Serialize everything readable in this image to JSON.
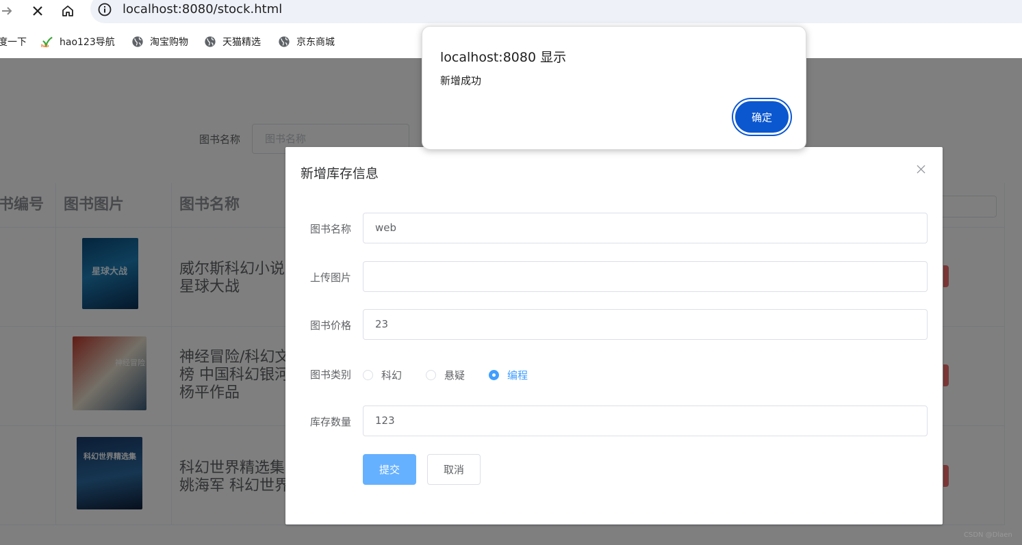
{
  "browser": {
    "url": "localhost:8080/stock.html",
    "bookmarks": [
      {
        "label": "度一下",
        "icon": "partial-clipped"
      },
      {
        "label": "hao123导航",
        "icon": "hao123-icon"
      },
      {
        "label": "淘宝购物",
        "icon": "globe-icon"
      },
      {
        "label": "天猫精选",
        "icon": "globe-icon"
      },
      {
        "label": "京东商城",
        "icon": "globe-icon"
      }
    ]
  },
  "page": {
    "search_label": "图书名称",
    "search_placeholder": "图书名称",
    "table": {
      "headers": [
        "书编号",
        "图书图片",
        "图书名称"
      ],
      "rows": [
        {
          "name": "威尔斯科幻小说\n星球大战",
          "cover_text": "星球大战"
        },
        {
          "name": "神经冒险/科幻文\n榜 中国科幻银河\n杨平作品",
          "cover_text": "神经冒险"
        },
        {
          "name": "科幻世界精选集\n姚海军 科幻世界",
          "cover_text": "科幻世界精选集"
        }
      ]
    }
  },
  "dialog": {
    "title": "新增库存信息",
    "fields": {
      "name_label": "图书名称",
      "name_value": "web",
      "image_label": "上传图片",
      "image_value": "",
      "price_label": "图书价格",
      "price_value": "23",
      "category_label": "图书类别",
      "stock_label": "库存数量",
      "stock_value": "123"
    },
    "category_options": [
      "科幻",
      "悬疑",
      "编程"
    ],
    "category_selected": "编程",
    "submit_label": "提交",
    "cancel_label": "取消"
  },
  "alert": {
    "title": "localhost:8080 显示",
    "message": "新增成功",
    "ok_label": "确定",
    "ok_color": "#0b57d0"
  },
  "watermark": "CSDN @Dlaen",
  "colors": {
    "primary": "#409eff",
    "primary_light": "#66b1ff",
    "danger": "#f56c6c",
    "overlay": "rgba(0,0,0,0.5)"
  }
}
